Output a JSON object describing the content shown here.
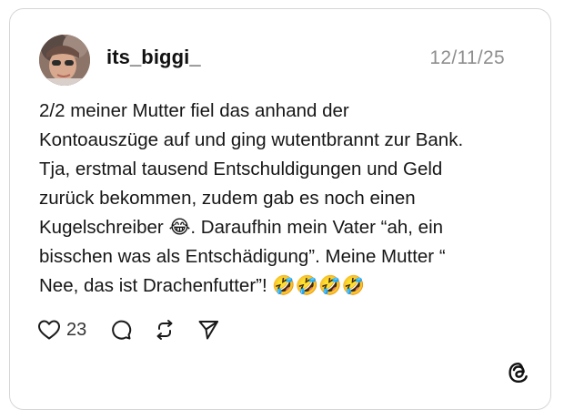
{
  "post": {
    "username": "its_biggi_",
    "date": "12/11/25",
    "text": "2/2 meiner Mutter fiel das anhand der\nKontoauszüge auf und ging wutentbrannt zur Bank.\nTja, erstmal tausend Entschuldigungen und Geld\nzurück bekommen, zudem gab es noch einen\nKugelschreiber 😂. Daraufhin mein Vater “ah, ein\nbisschen was als Entschädigung”. Meine Mutter “\nNee, das ist Drachenfutter”! 🤣🤣🤣🤣"
  },
  "actions": {
    "like_count": "23",
    "like_icon": "heart-icon",
    "comment_icon": "comment-bubble-icon",
    "repost_icon": "repost-icon",
    "share_icon": "send-icon"
  },
  "brand": {
    "logo": "threads-logo-icon"
  },
  "colors": {
    "border": "#d6d6d6",
    "date": "#8e8e8e",
    "text": "#161616"
  }
}
